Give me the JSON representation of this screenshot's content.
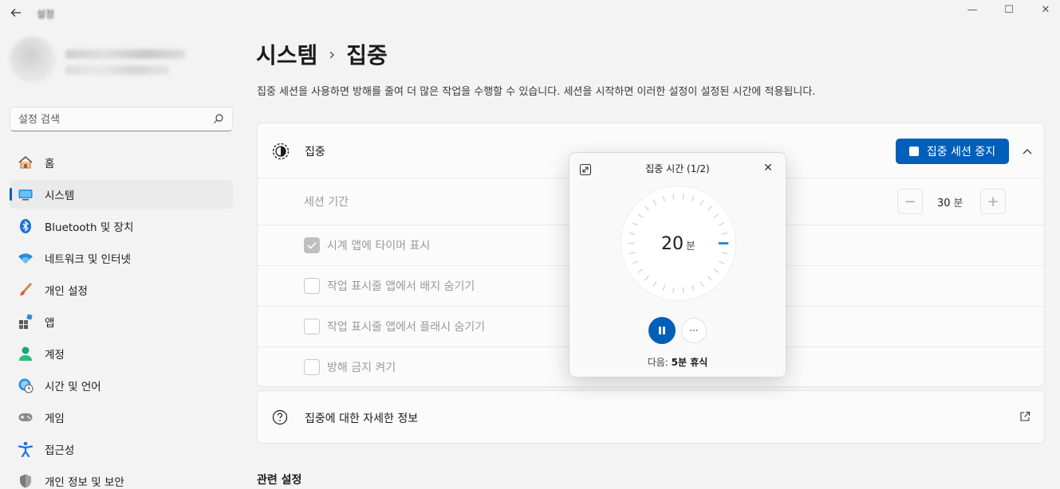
{
  "window": {
    "title": "설정",
    "minimize": "—",
    "maximize": "☐",
    "close": "✕"
  },
  "sidebar": {
    "search_placeholder": "설정 검색",
    "items": [
      {
        "label": "홈",
        "icon": "home-icon"
      },
      {
        "label": "시스템",
        "icon": "system-icon",
        "active": true
      },
      {
        "label": "Bluetooth 및 장치",
        "icon": "bluetooth-icon"
      },
      {
        "label": "네트워크 및 인터넷",
        "icon": "wifi-icon"
      },
      {
        "label": "개인 설정",
        "icon": "brush-icon"
      },
      {
        "label": "앱",
        "icon": "apps-icon"
      },
      {
        "label": "계정",
        "icon": "account-icon"
      },
      {
        "label": "시간 및 언어",
        "icon": "globe-clock-icon"
      },
      {
        "label": "게임",
        "icon": "gamepad-icon"
      },
      {
        "label": "접근성",
        "icon": "accessibility-icon"
      },
      {
        "label": "개인 정보 및 보안",
        "icon": "shield-icon"
      }
    ]
  },
  "main": {
    "breadcrumb_parent": "시스템",
    "breadcrumb_separator": "›",
    "breadcrumb_current": "집중",
    "description": "집중 세션을 사용하면 방해를 줄여 더 많은 작업을 수행할 수 있습니다. 세션을 시작하면 이러한 설정이 설정된 시간에 적용됩니다.",
    "focus_card": {
      "title": "집중",
      "stop_button": "집중 세션 중지",
      "session_duration_label": "세션 기간",
      "duration_value": "30",
      "duration_unit": "분",
      "minus": "−",
      "plus": "+",
      "options": [
        {
          "label": "시계 앱에 타이머 표시",
          "checked": true
        },
        {
          "label": "작업 표시줄 앱에서 배지 숨기기",
          "checked": false
        },
        {
          "label": "작업 표시줄 앱에서 플래시 숨기기",
          "checked": false
        },
        {
          "label": "방해 금지 켜기",
          "checked": false
        }
      ]
    },
    "info_card": {
      "title": "집중에 대한 자세한 정보"
    },
    "related_heading": "관련 설정"
  },
  "popup": {
    "title": "집중 시간 (1/2)",
    "close": "✕",
    "timer_value": "20",
    "timer_unit": "분",
    "progress_fraction": 0.0,
    "more": "···",
    "next_prefix": "다음: ",
    "next_value": "5분 휴식"
  },
  "colors": {
    "accent": "#005fb8",
    "background": "#f3f3f3",
    "card": "#fbfbfb"
  }
}
